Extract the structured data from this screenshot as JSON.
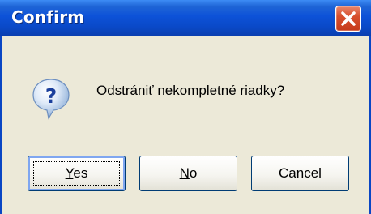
{
  "window": {
    "title": "Confirm",
    "close_icon": "close-icon"
  },
  "dialog": {
    "icon": "question-icon",
    "message": "Odstrániť nekompletné riadky?"
  },
  "buttons": {
    "yes": {
      "mnemonic": "Y",
      "rest": "es"
    },
    "no": {
      "mnemonic": "N",
      "rest": "o"
    },
    "cancel": "Cancel"
  },
  "colors": {
    "titlebar": "#0a49c8",
    "dialog_bg": "#ece9d8",
    "close_button": "#d8502e"
  }
}
